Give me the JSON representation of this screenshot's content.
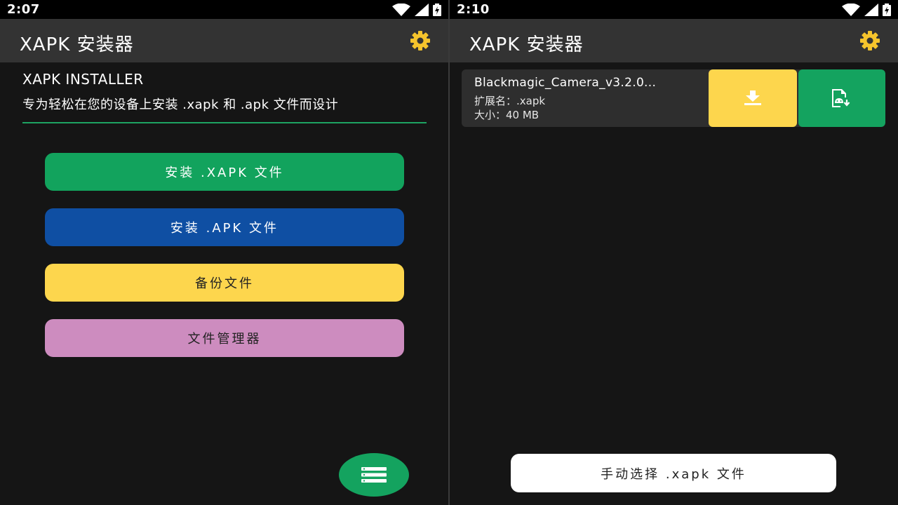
{
  "left": {
    "status_time": "2:07",
    "app_title": "XAPK 安装器",
    "settings_icon": "gear-icon",
    "hero_title": "XAPK INSTALLER",
    "hero_subtitle": "专为轻松在您的设备上安装 .xapk 和 .apk 文件而设计",
    "buttons": [
      {
        "label": "安装 .XAPK 文件",
        "color": "#12a35d"
      },
      {
        "label": "安装 .APK 文件",
        "color": "#0f4fa3"
      },
      {
        "label": "备份文件",
        "color": "#fdd64d"
      },
      {
        "label": "文件管理器",
        "color": "#cd8cbf"
      }
    ],
    "fab_icon": "list-icon"
  },
  "right": {
    "status_time": "2:10",
    "app_title": "XAPK 安装器",
    "settings_icon": "gear-icon",
    "file": {
      "name": "Blackmagic_Camera_v3.2.0...",
      "extension": "扩展名：.xapk",
      "size": "大小：40 MB",
      "download_icon": "download-icon",
      "install_icon": "android-install-icon"
    },
    "manual_select_label": "手动选择 .xapk 文件"
  },
  "colors": {
    "accent_green": "#12a35d",
    "accent_blue": "#0f4fa3",
    "accent_yellow": "#fdd64d",
    "accent_pink": "#cd8cbf",
    "appbar": "#333333",
    "background": "#151515"
  }
}
